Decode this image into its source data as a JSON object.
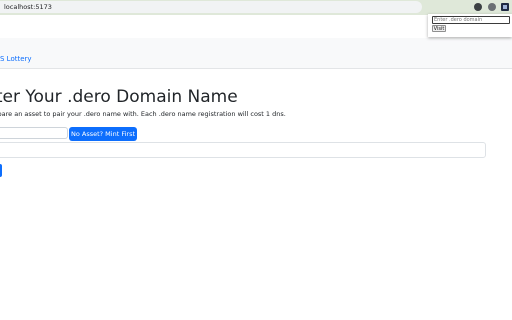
{
  "browser": {
    "url": "localhost:5173"
  },
  "extension_popup": {
    "input_placeholder": "Enter .dero domain",
    "visit_label": "Visit"
  },
  "navbar": {
    "link_label": "S Lottery"
  },
  "main": {
    "title": "ster Your .dero Domain Name",
    "description": "repare an asset to pair your .dero name with. Each .dero name registration will cost 1 dns.",
    "mint_button_label": "No Asset? Mint First"
  },
  "colors": {
    "primary": "#0d6efd",
    "chrome_bar": "#dfe8d9"
  }
}
